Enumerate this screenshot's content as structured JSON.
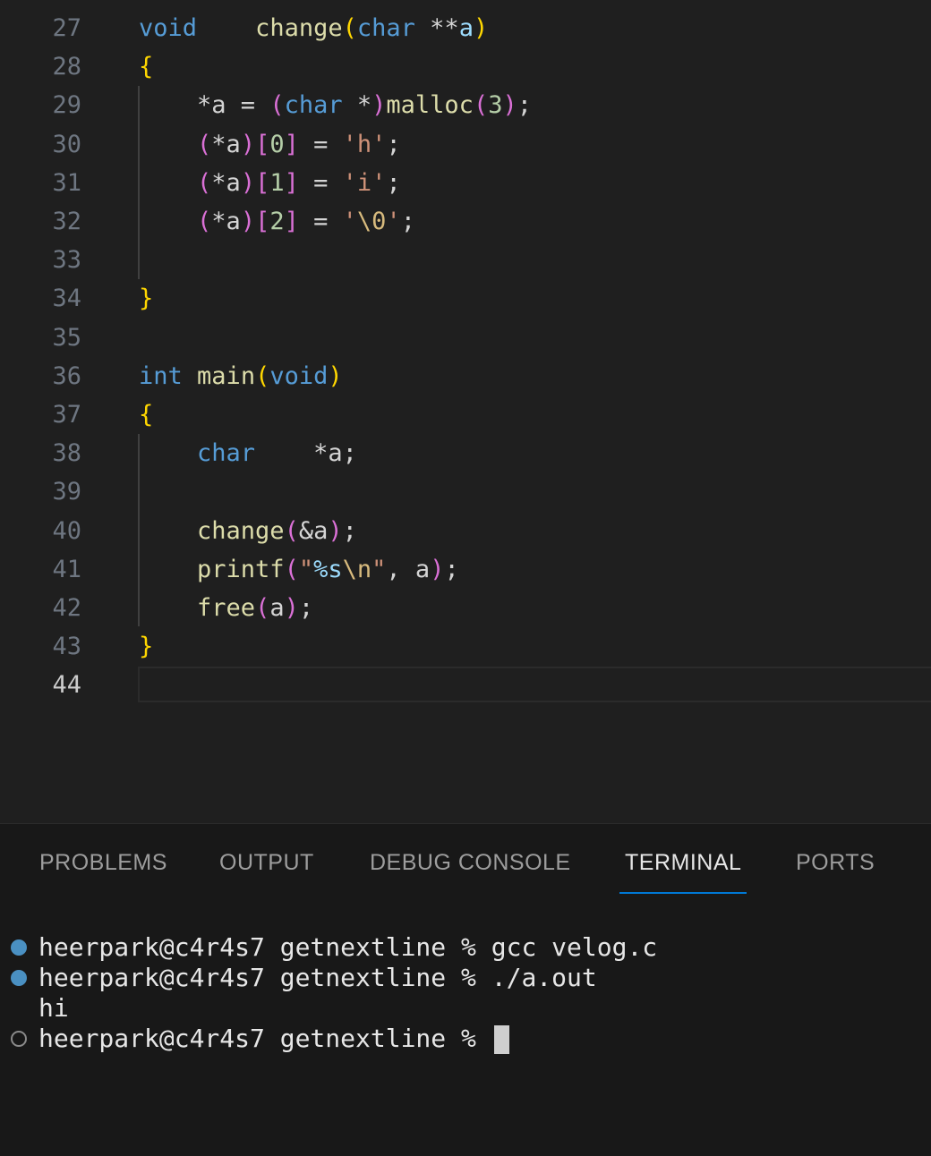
{
  "editor": {
    "lines": [
      {
        "num": "27",
        "parts": [
          [
            "kw",
            "void"
          ],
          [
            "op",
            "    "
          ],
          [
            "fn",
            "change"
          ],
          [
            "br1",
            "("
          ],
          [
            "kw",
            "char"
          ],
          [
            "op",
            " **"
          ],
          [
            "var",
            "a"
          ],
          [
            "br1",
            ")"
          ]
        ]
      },
      {
        "num": "28",
        "parts": [
          [
            "br1",
            "{"
          ]
        ]
      },
      {
        "num": "29",
        "parts": [
          [
            "op",
            "    *a = "
          ],
          [
            "br2",
            "("
          ],
          [
            "kw",
            "char"
          ],
          [
            "op",
            " *"
          ],
          [
            "br2",
            ")"
          ],
          [
            "fn",
            "malloc"
          ],
          [
            "br2",
            "("
          ],
          [
            "num",
            "3"
          ],
          [
            "br2",
            ")"
          ],
          [
            "op",
            ";"
          ]
        ]
      },
      {
        "num": "30",
        "parts": [
          [
            "op",
            "    "
          ],
          [
            "br2",
            "("
          ],
          [
            "op",
            "*a"
          ],
          [
            "br2",
            ")"
          ],
          [
            "br2",
            "["
          ],
          [
            "num",
            "0"
          ],
          [
            "br2",
            "]"
          ],
          [
            "op",
            " = "
          ],
          [
            "str",
            "'h'"
          ],
          [
            "op",
            ";"
          ]
        ]
      },
      {
        "num": "31",
        "parts": [
          [
            "op",
            "    "
          ],
          [
            "br2",
            "("
          ],
          [
            "op",
            "*a"
          ],
          [
            "br2",
            ")"
          ],
          [
            "br2",
            "["
          ],
          [
            "num",
            "1"
          ],
          [
            "br2",
            "]"
          ],
          [
            "op",
            " = "
          ],
          [
            "str",
            "'i'"
          ],
          [
            "op",
            ";"
          ]
        ]
      },
      {
        "num": "32",
        "parts": [
          [
            "op",
            "    "
          ],
          [
            "br2",
            "("
          ],
          [
            "op",
            "*a"
          ],
          [
            "br2",
            ")"
          ],
          [
            "br2",
            "["
          ],
          [
            "num",
            "2"
          ],
          [
            "br2",
            "]"
          ],
          [
            "op",
            " = "
          ],
          [
            "str",
            "'"
          ],
          [
            "esc",
            "\\0"
          ],
          [
            "str",
            "'"
          ],
          [
            "op",
            ";"
          ]
        ]
      },
      {
        "num": "33",
        "parts": []
      },
      {
        "num": "34",
        "parts": [
          [
            "br1",
            "}"
          ]
        ]
      },
      {
        "num": "35",
        "parts": []
      },
      {
        "num": "36",
        "parts": [
          [
            "kw",
            "int"
          ],
          [
            "op",
            " "
          ],
          [
            "fn",
            "main"
          ],
          [
            "br1",
            "("
          ],
          [
            "kw",
            "void"
          ],
          [
            "br1",
            ")"
          ]
        ]
      },
      {
        "num": "37",
        "parts": [
          [
            "br1",
            "{"
          ]
        ]
      },
      {
        "num": "38",
        "parts": [
          [
            "op",
            "    "
          ],
          [
            "kw",
            "char"
          ],
          [
            "op",
            "    *a;"
          ]
        ]
      },
      {
        "num": "39",
        "parts": []
      },
      {
        "num": "40",
        "parts": [
          [
            "op",
            "    "
          ],
          [
            "fn",
            "change"
          ],
          [
            "br2",
            "("
          ],
          [
            "op",
            "&a"
          ],
          [
            "br2",
            ")"
          ],
          [
            "op",
            ";"
          ]
        ]
      },
      {
        "num": "41",
        "parts": [
          [
            "op",
            "    "
          ],
          [
            "fn",
            "printf"
          ],
          [
            "br2",
            "("
          ],
          [
            "str",
            "\""
          ],
          [
            "fmt",
            "%s"
          ],
          [
            "esc",
            "\\n"
          ],
          [
            "str",
            "\""
          ],
          [
            "op",
            ", a"
          ],
          [
            "br2",
            ")"
          ],
          [
            "op",
            ";"
          ]
        ]
      },
      {
        "num": "42",
        "parts": [
          [
            "op",
            "    "
          ],
          [
            "fn",
            "free"
          ],
          [
            "br2",
            "("
          ],
          [
            "op",
            "a"
          ],
          [
            "br2",
            ")"
          ],
          [
            "op",
            ";"
          ]
        ]
      },
      {
        "num": "43",
        "parts": [
          [
            "br1",
            "}"
          ]
        ]
      },
      {
        "num": "44",
        "parts": []
      }
    ],
    "active_line": "44"
  },
  "panel": {
    "tabs": [
      {
        "id": "problems",
        "label": "PROBLEMS"
      },
      {
        "id": "output",
        "label": "OUTPUT"
      },
      {
        "id": "debug-console",
        "label": "DEBUG CONSOLE"
      },
      {
        "id": "terminal",
        "label": "TERMINAL"
      },
      {
        "id": "ports",
        "label": "PORTS"
      }
    ],
    "active_tab": "terminal"
  },
  "terminal": {
    "lines": [
      {
        "status": "done",
        "text": "heerpark@c4r4s7 getnextline % gcc velog.c"
      },
      {
        "status": "done",
        "text": "heerpark@c4r4s7 getnextline % ./a.out"
      },
      {
        "status": "none",
        "text": "hi"
      },
      {
        "status": "pending",
        "text": "heerpark@c4r4s7 getnextline % "
      }
    ]
  },
  "colors": {
    "editor_bg": "#1f1f1f",
    "panel_bg": "#181818",
    "keyword": "#569cd6",
    "function": "#dcdcaa",
    "bracket_level1": "#ffd700",
    "bracket_level2": "#da70d6",
    "string": "#ce9178",
    "number": "#b5cea8",
    "tab_active_underline": "#0078d4",
    "status_dot": "#4a90c2"
  }
}
